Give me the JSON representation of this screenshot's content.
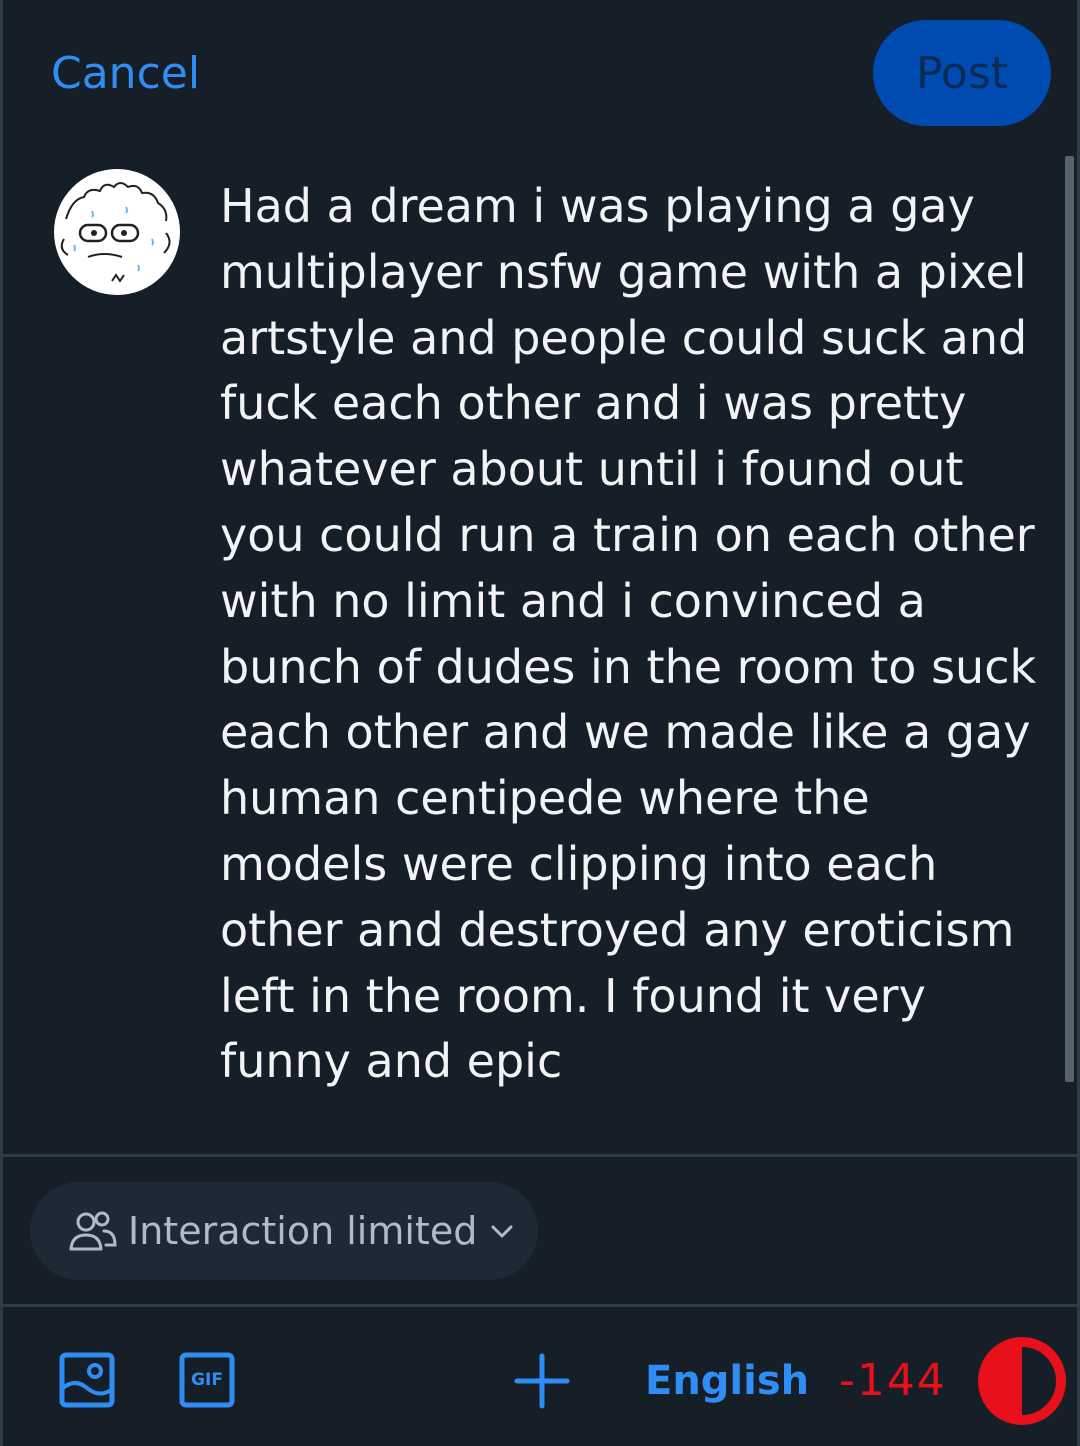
{
  "header": {
    "cancel_label": "Cancel",
    "post_label": "Post"
  },
  "composer": {
    "text": "Had a dream i was playing a gay multiplayer nsfw game with a pixel artstyle and people could suck and fuck each other and i was pretty whatever about until i found out you could run a train on each other with no limit and i convinced a bunch of dudes in the room to suck each other and we made like a gay human centipede where the models were clipping into each other and destroyed any eroticism left in the room. I found it very funny and epic"
  },
  "interaction": {
    "label": "Interaction limited",
    "icon": "people-icon"
  },
  "toolbar": {
    "image_icon": "image-icon",
    "gif_label": "GIF",
    "add_icon": "plus-icon",
    "language": "English",
    "char_count": "-144",
    "progress_icon": "character-progress-ring"
  },
  "colors": {
    "accent": "#2f8ef5",
    "post_button": "#004bb1",
    "background": "#161e27",
    "over_limit": "#e8101a"
  }
}
